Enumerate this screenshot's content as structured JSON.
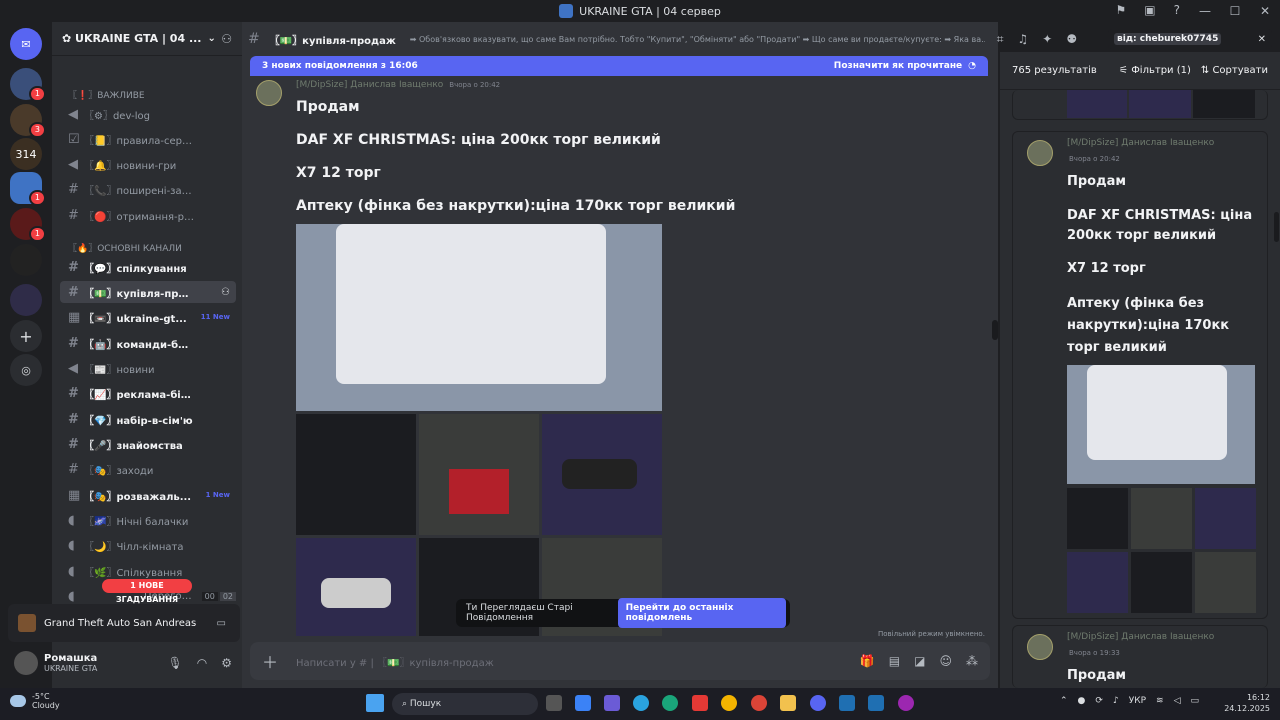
{
  "window": {
    "title": "UKRAINE GTA | 04 сервер"
  },
  "server": {
    "name": "UKRAINE GTA | 04 ..."
  },
  "guild_badges": [
    "1",
    "3",
    "314",
    "1",
    "1"
  ],
  "categories": {
    "important": "〖❗〗ВАЖЛИВЕ",
    "main": "〖🔥〗ОСНОВНІ КАНАЛИ"
  },
  "channels": [
    {
      "name": "〖⚙〗dev-log"
    },
    {
      "name": "〖📒〗правила-серверу"
    },
    {
      "name": "〖🔔〗новини-гри"
    },
    {
      "name": "〖📞〗поширені-запит..."
    },
    {
      "name": "〖🔴〗отримання-ролей"
    },
    {
      "name": "〖💬〗спілкування"
    },
    {
      "name": "〖💵〗купівля-прод..."
    },
    {
      "name": "〖📼〗ukraine-gt...",
      "badge": "11 New"
    },
    {
      "name": "〖🤖〗команди-бота"
    },
    {
      "name": "〖📰〗новини"
    },
    {
      "name": "〖📈〗реклама-бізнесу"
    },
    {
      "name": "〖💎〗набір-в-сім'ю"
    },
    {
      "name": "〖🎤〗знайомства"
    },
    {
      "name": "〖🎭〗заходи"
    },
    {
      "name": "〖🎭〗розважаль...",
      "badge": "1 New"
    },
    {
      "name": "〖🌌〗Нічні балачки"
    },
    {
      "name": "〖🌙〗Чілл-кімната"
    },
    {
      "name": "〖🌿〗Спілкування"
    },
    {
      "name": "Переговo..."
    }
  ],
  "mention_pill": "1 НОВЕ ЗГАДУВАННЯ",
  "voice_counts": [
    "00",
    "02"
  ],
  "activity": {
    "game": "Grand Theft Auto San Andreas"
  },
  "user": {
    "name": "Ромашка",
    "status": "UKRAINE GTA"
  },
  "chanbar": {
    "name": "〖💵〗купівля-продаж",
    "topic": "➡ Обов'язково вказувати, що саме Вам потрібно. Тобто \"Купити\", \"Обміняти\" або \"Продати\" ➡ Що саме ви продаєте/купуєте: ➡ Яка ва..."
  },
  "search": {
    "tag": "від:",
    "value": "cheburek07745"
  },
  "newbar": {
    "text": "3 нових повідомлення з 16:06",
    "mark": "Позначити як прочитане"
  },
  "message": {
    "author": "[M/DipSize] Данислав Іващенко",
    "time": "Вчора о 20:42",
    "lines": [
      "Продам",
      "DAF XF CHRISTMAS: ціна 200кк торг великий",
      "X7 12 торг",
      "Аптеку (фінка без накрутки):ціна 170кк торг великий"
    ]
  },
  "oldmsg": {
    "text": "Ти Переглядаєш Старі Повідомлення",
    "button": "Перейти до останніх повідомлень"
  },
  "slowmode": "Повільний режим увімкнено.",
  "composer": {
    "placeholder": "Написати у # | 〖💵〗купівля-продаж"
  },
  "results": {
    "count": "765 результатів",
    "filters": "Фільтри (1)",
    "sort": "Сортувати"
  },
  "result_card1": {
    "author": "[M/DipSize] Данислав Іващенко",
    "time": "Вчора о 20:42",
    "lines": [
      "Продам",
      "DAF XF CHRISTMAS: ціна 200кк торг великий",
      "X7 12 торг",
      "Аптеку (фінка без накрутки):ціна 170кк торг великий"
    ]
  },
  "result_card2": {
    "author": "[M/DipSize] Данислав Іващенко",
    "time": "Вчора о 19:33",
    "lines": [
      "Продам"
    ]
  },
  "taskbar": {
    "weather_temp": "-5°C",
    "weather_text": "Cloudy",
    "search": "Пошук",
    "lang": "УКР",
    "time": "16:12",
    "date": "24.12.2025"
  }
}
